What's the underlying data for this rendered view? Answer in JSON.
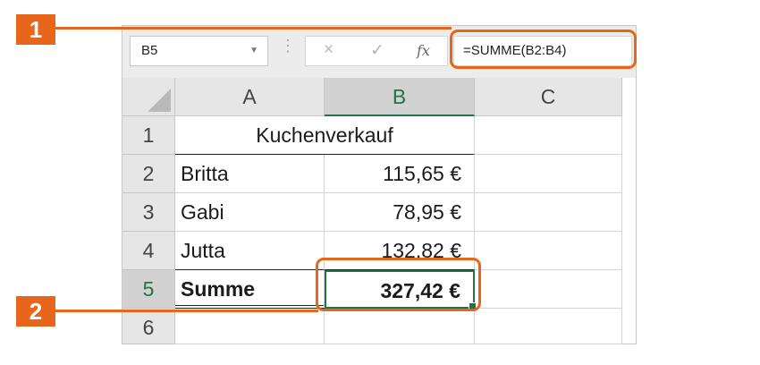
{
  "formula_bar": {
    "name_box": "B5",
    "cancel_icon": "×",
    "enter_icon": "✓",
    "fx_label": "fx",
    "formula": "=SUMME(B2:B4)"
  },
  "columns": [
    "A",
    "B",
    "C"
  ],
  "rows": [
    {
      "num": "1",
      "a": "Kuchenverkauf",
      "b": "",
      "c": ""
    },
    {
      "num": "2",
      "a": "Britta",
      "b": "115,65 €",
      "c": ""
    },
    {
      "num": "3",
      "a": "Gabi",
      "b": "78,95 €",
      "c": ""
    },
    {
      "num": "4",
      "a": "Jutta",
      "b": "132,82 €",
      "c": ""
    },
    {
      "num": "5",
      "a": "Summe",
      "b": "327,42 €",
      "c": ""
    },
    {
      "num": "6",
      "a": "",
      "b": "",
      "c": ""
    }
  ],
  "callouts": [
    "1",
    "2"
  ],
  "colors": {
    "accent": "#e8651c",
    "excel_green": "#217346"
  }
}
